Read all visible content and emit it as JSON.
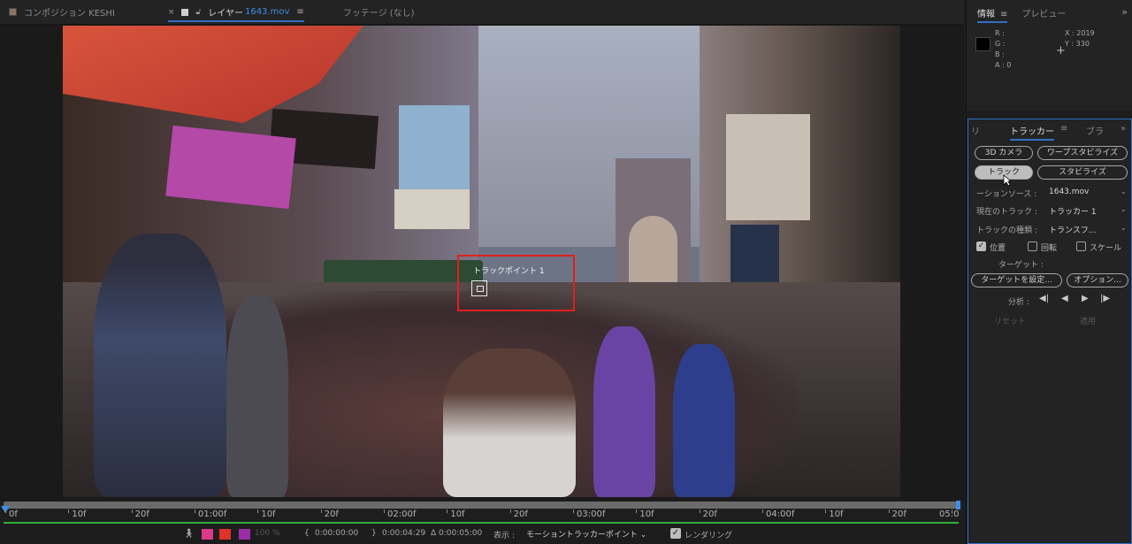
{
  "tabs": [
    {
      "label": "コンポジション KESHI"
    },
    {
      "label": "レイヤー",
      "file": "1643.mov",
      "menu": "≡"
    },
    {
      "label": "フッテージ (なし)"
    }
  ],
  "track_point": {
    "label": "トラックポイント 1"
  },
  "ruler": {
    "ticks": [
      "0f",
      "10f",
      "20f",
      "01:00f",
      "10f",
      "20f",
      "02:00f",
      "10f",
      "20f",
      "03:00f",
      "10f",
      "20f",
      "04:00f",
      "10f",
      "20f",
      "05:0"
    ]
  },
  "bottom_bar": {
    "zoom": "100 %",
    "time_in": "0:00:00:00",
    "time_out": "0:00:04:29",
    "duration": "Δ 0:00:05:00",
    "view_label": "表示 :",
    "view_value": "モーショントラッカーポイント",
    "render_label": "レンダリング",
    "colors": {
      "swatch1": "#d93a8a",
      "swatch2": "#e0312a",
      "swatch3": "#9b2ea8"
    }
  },
  "info_panel": {
    "tab_info": "情報",
    "tab_preview": "プレビュー",
    "r": "R :",
    "g": "G :",
    "b": "B :",
    "a": "A :  0",
    "x": "X :  2019",
    "y": "Y :  330"
  },
  "tracker_panel": {
    "tab_left": "リ",
    "tab_tracker": "トラッカー",
    "tab_right": "ブラ",
    "btn_camera": "3D カメラ",
    "btn_warp": "ワープスタビライズ",
    "btn_track": "トラック",
    "btn_stabilize": "スタビライズ",
    "source_label": "ーションソース :",
    "source_value": "1643.mov",
    "current_label": "現在のトラック :",
    "current_value": "トラッカー 1",
    "type_label": "トラックの種類 :",
    "type_value": "トランスフ...",
    "position": "位置",
    "rotation": "回転",
    "scale": "スケール",
    "target_label": "ターゲット :",
    "btn_set_target": "ターゲットを設定...",
    "btn_options": "オプション...",
    "analyze_label": "分析 :",
    "reset": "リセット",
    "apply": "適用"
  }
}
